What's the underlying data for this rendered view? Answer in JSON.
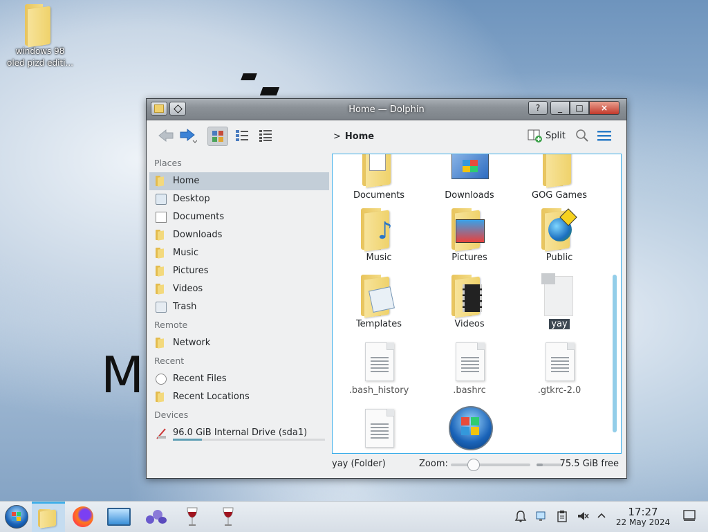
{
  "desktop": {
    "icon_label": "windows 98\noled pizd editi..."
  },
  "window": {
    "title": "Home — Dolphin",
    "help": "?",
    "minimize": "_",
    "maximize": "□",
    "close": "×"
  },
  "toolbar": {
    "breadcrumb_chevron": ">",
    "breadcrumb": "Home",
    "split": "Split"
  },
  "places": {
    "sections": {
      "places": "Places",
      "remote": "Remote",
      "recent": "Recent",
      "devices": "Devices"
    },
    "items": [
      "Home",
      "Desktop",
      "Documents",
      "Downloads",
      "Music",
      "Pictures",
      "Videos",
      "Trash"
    ],
    "remote_items": [
      "Network"
    ],
    "recent_items": [
      "Recent Files",
      "Recent Locations"
    ],
    "devices_items": [
      "96.0 GiB Internal Drive (sda1)"
    ],
    "drive_usage_fraction": 0.19
  },
  "files": [
    "Documents",
    "Downloads",
    "GOG Games",
    "Music",
    "Pictures",
    "Public",
    "Templates",
    "Videos",
    "yay",
    ".bash_history",
    ".bashrc",
    ".gtkrc-2.0",
    "",
    ""
  ],
  "status": {
    "selection": "yay (Folder)",
    "zoom_label": "Zoom:",
    "free_space": "75.5 GiB free"
  },
  "taskbar": {
    "time": "17:27",
    "date": "22 May 2024"
  },
  "colors": {
    "accent": "#3daee9",
    "selection_bg": "#3d4852",
    "close_red": "#c2392b"
  }
}
